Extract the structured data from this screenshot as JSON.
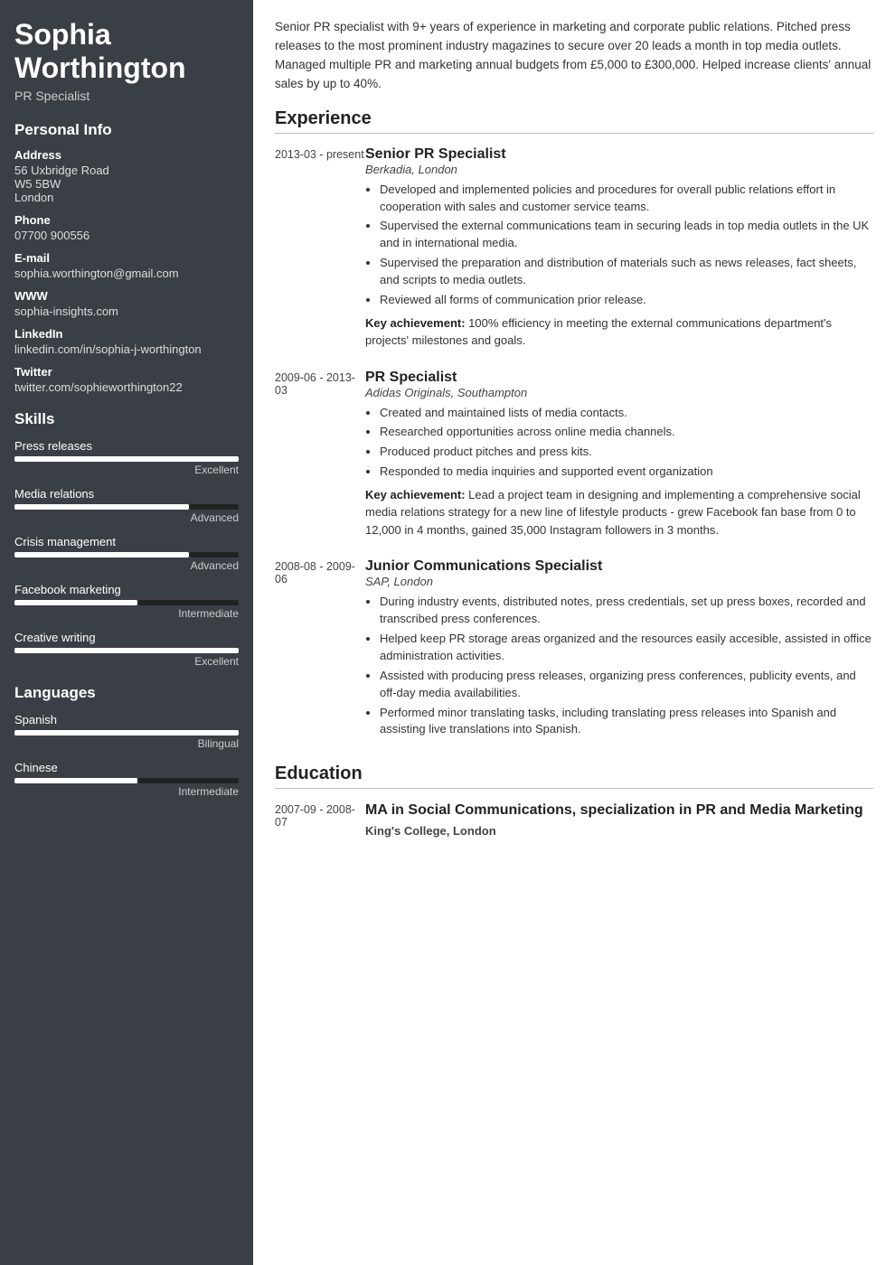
{
  "sidebar": {
    "name": "Sophia Worthington",
    "title": "PR Specialist",
    "personal_info_label": "Personal Info",
    "address_label": "Address",
    "address_lines": [
      "56 Uxbridge Road",
      "W5 5BW",
      "London"
    ],
    "phone_label": "Phone",
    "phone_value": "07700 900556",
    "email_label": "E-mail",
    "email_value": "sophia.worthington@gmail.com",
    "www_label": "WWW",
    "www_value": "sophia-insights.com",
    "linkedin_label": "LinkedIn",
    "linkedin_value": "linkedin.com/in/sophia-j-worthington",
    "twitter_label": "Twitter",
    "twitter_value": "twitter.com/sophieworthington22",
    "skills_label": "Skills",
    "skills": [
      {
        "name": "Press releases",
        "level": "Excellent",
        "fill_pct": 100,
        "dark_pct": 0
      },
      {
        "name": "Media relations",
        "level": "Advanced",
        "fill_pct": 78,
        "dark_pct": 22
      },
      {
        "name": "Crisis management",
        "level": "Advanced",
        "fill_pct": 78,
        "dark_pct": 22
      },
      {
        "name": "Facebook marketing",
        "level": "Intermediate",
        "fill_pct": 55,
        "dark_pct": 45
      },
      {
        "name": "Creative writing",
        "level": "Excellent",
        "fill_pct": 100,
        "dark_pct": 0
      }
    ],
    "languages_label": "Languages",
    "languages": [
      {
        "name": "Spanish",
        "level": "Bilingual",
        "fill_pct": 100,
        "dark_pct": 0
      },
      {
        "name": "Chinese",
        "level": "Intermediate",
        "fill_pct": 55,
        "dark_pct": 45
      }
    ]
  },
  "main": {
    "summary": "Senior PR specialist with 9+ years of experience in marketing and corporate public relations. Pitched press releases to the most prominent industry magazines to secure over 20 leads a month in top media outlets. Managed multiple PR and marketing annual budgets from £5,000 to £300,000. Helped increase clients' annual sales by up to 40%.",
    "experience_title": "Experience",
    "experiences": [
      {
        "date": "2013-03 - present",
        "role": "Senior PR Specialist",
        "company": "Berkadia, London",
        "bullets": [
          "Developed and implemented policies and procedures for overall public relations effort in cooperation with sales and customer service teams.",
          "Supervised the external communications team in securing leads in top media outlets in the UK and in international media.",
          "Supervised the preparation and distribution of materials such as news releases, fact sheets, and scripts to media outlets.",
          "Reviewed all forms of communication prior release."
        ],
        "key_achievement": "100% efficiency in meeting the external communications department's projects' milestones and goals."
      },
      {
        "date": "2009-06 - 2013-03",
        "role": "PR Specialist",
        "company": "Adidas Originals, Southampton",
        "bullets": [
          "Created and maintained lists of media contacts.",
          "Researched opportunities across online media channels.",
          "Produced product pitches and press kits.",
          "Responded to media inquiries and supported event organization"
        ],
        "key_achievement": "Lead a project team in designing and implementing a comprehensive social media relations strategy for a new line of lifestyle products - grew Facebook fan base from 0 to 12,000 in 4 months, gained 35,000 Instagram followers in 3 months."
      },
      {
        "date": "2008-08 - 2009-06",
        "role": "Junior Communications Specialist",
        "company": "SAP, London",
        "bullets": [
          "During industry events, distributed notes, press credentials, set up press boxes, recorded and transcribed press conferences.",
          "Helped keep PR storage areas organized and the resources easily accesible, assisted in office administration activities.",
          "Assisted with producing press releases, organizing press conferences, publicity events, and off-day media availabilities.",
          "Performed minor translating tasks, including translating press releases into Spanish and assisting live translations into Spanish."
        ],
        "key_achievement": null
      }
    ],
    "education_title": "Education",
    "educations": [
      {
        "date": "2007-09 - 2008-07",
        "degree": "MA in Social Communications, specialization in PR and Media Marketing",
        "school": "King's College, London"
      }
    ]
  }
}
